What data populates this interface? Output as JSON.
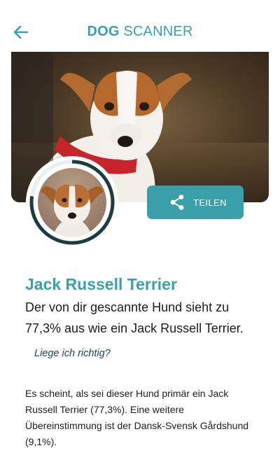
{
  "header": {
    "title_bold": "DOG",
    "title_light": " SCANNER",
    "back_icon": "arrow-left-icon"
  },
  "colors": {
    "accent": "#3aa0ad",
    "share_button_bg": "#3b9fa9",
    "ring_dark": "#1e3b3f",
    "ring_track": "#e7eff0"
  },
  "share": {
    "label": "TEILEN",
    "icon": "share-icon"
  },
  "result": {
    "match_fraction": 0.773,
    "breed_name": "Jack Russell Terrier",
    "summary_line": "Der von dir gescannte Hund sieht zu 77,3% aus wie ein Jack Russell Terrier.",
    "feedback_link": "Liege ich richtig?",
    "detail_text": "Es scheint, als sei dieser Hund primär ein Jack Russell Terrier (77,3%). Eine weitere Übereinstimmung ist der Dansk-Svensk Gårdshund (9,1%)."
  }
}
